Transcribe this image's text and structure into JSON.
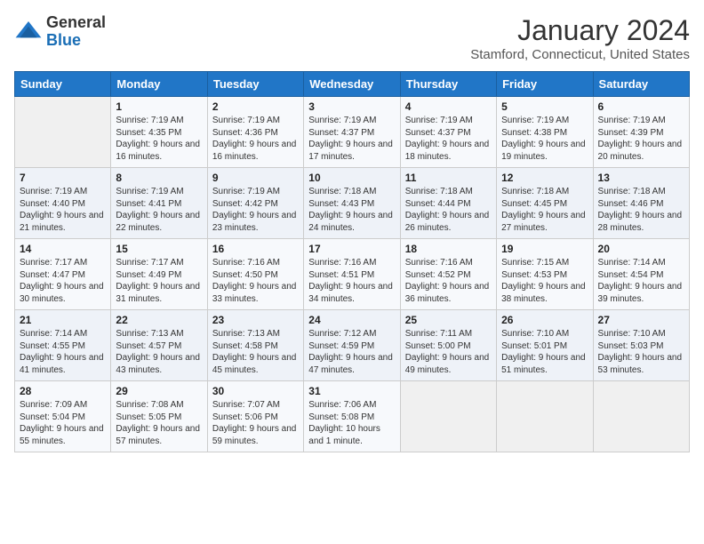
{
  "header": {
    "logo": {
      "general": "General",
      "blue": "Blue"
    },
    "month_title": "January 2024",
    "subtitle": "Stamford, Connecticut, United States"
  },
  "weekdays": [
    "Sunday",
    "Monday",
    "Tuesday",
    "Wednesday",
    "Thursday",
    "Friday",
    "Saturday"
  ],
  "weeks": [
    [
      {
        "day": "",
        "empty": true
      },
      {
        "day": "1",
        "sunrise": "Sunrise: 7:19 AM",
        "sunset": "Sunset: 4:35 PM",
        "daylight": "Daylight: 9 hours and 16 minutes."
      },
      {
        "day": "2",
        "sunrise": "Sunrise: 7:19 AM",
        "sunset": "Sunset: 4:36 PM",
        "daylight": "Daylight: 9 hours and 16 minutes."
      },
      {
        "day": "3",
        "sunrise": "Sunrise: 7:19 AM",
        "sunset": "Sunset: 4:37 PM",
        "daylight": "Daylight: 9 hours and 17 minutes."
      },
      {
        "day": "4",
        "sunrise": "Sunrise: 7:19 AM",
        "sunset": "Sunset: 4:37 PM",
        "daylight": "Daylight: 9 hours and 18 minutes."
      },
      {
        "day": "5",
        "sunrise": "Sunrise: 7:19 AM",
        "sunset": "Sunset: 4:38 PM",
        "daylight": "Daylight: 9 hours and 19 minutes."
      },
      {
        "day": "6",
        "sunrise": "Sunrise: 7:19 AM",
        "sunset": "Sunset: 4:39 PM",
        "daylight": "Daylight: 9 hours and 20 minutes."
      }
    ],
    [
      {
        "day": "7",
        "sunrise": "Sunrise: 7:19 AM",
        "sunset": "Sunset: 4:40 PM",
        "daylight": "Daylight: 9 hours and 21 minutes."
      },
      {
        "day": "8",
        "sunrise": "Sunrise: 7:19 AM",
        "sunset": "Sunset: 4:41 PM",
        "daylight": "Daylight: 9 hours and 22 minutes."
      },
      {
        "day": "9",
        "sunrise": "Sunrise: 7:19 AM",
        "sunset": "Sunset: 4:42 PM",
        "daylight": "Daylight: 9 hours and 23 minutes."
      },
      {
        "day": "10",
        "sunrise": "Sunrise: 7:18 AM",
        "sunset": "Sunset: 4:43 PM",
        "daylight": "Daylight: 9 hours and 24 minutes."
      },
      {
        "day": "11",
        "sunrise": "Sunrise: 7:18 AM",
        "sunset": "Sunset: 4:44 PM",
        "daylight": "Daylight: 9 hours and 26 minutes."
      },
      {
        "day": "12",
        "sunrise": "Sunrise: 7:18 AM",
        "sunset": "Sunset: 4:45 PM",
        "daylight": "Daylight: 9 hours and 27 minutes."
      },
      {
        "day": "13",
        "sunrise": "Sunrise: 7:18 AM",
        "sunset": "Sunset: 4:46 PM",
        "daylight": "Daylight: 9 hours and 28 minutes."
      }
    ],
    [
      {
        "day": "14",
        "sunrise": "Sunrise: 7:17 AM",
        "sunset": "Sunset: 4:47 PM",
        "daylight": "Daylight: 9 hours and 30 minutes."
      },
      {
        "day": "15",
        "sunrise": "Sunrise: 7:17 AM",
        "sunset": "Sunset: 4:49 PM",
        "daylight": "Daylight: 9 hours and 31 minutes."
      },
      {
        "day": "16",
        "sunrise": "Sunrise: 7:16 AM",
        "sunset": "Sunset: 4:50 PM",
        "daylight": "Daylight: 9 hours and 33 minutes."
      },
      {
        "day": "17",
        "sunrise": "Sunrise: 7:16 AM",
        "sunset": "Sunset: 4:51 PM",
        "daylight": "Daylight: 9 hours and 34 minutes."
      },
      {
        "day": "18",
        "sunrise": "Sunrise: 7:16 AM",
        "sunset": "Sunset: 4:52 PM",
        "daylight": "Daylight: 9 hours and 36 minutes."
      },
      {
        "day": "19",
        "sunrise": "Sunrise: 7:15 AM",
        "sunset": "Sunset: 4:53 PM",
        "daylight": "Daylight: 9 hours and 38 minutes."
      },
      {
        "day": "20",
        "sunrise": "Sunrise: 7:14 AM",
        "sunset": "Sunset: 4:54 PM",
        "daylight": "Daylight: 9 hours and 39 minutes."
      }
    ],
    [
      {
        "day": "21",
        "sunrise": "Sunrise: 7:14 AM",
        "sunset": "Sunset: 4:55 PM",
        "daylight": "Daylight: 9 hours and 41 minutes."
      },
      {
        "day": "22",
        "sunrise": "Sunrise: 7:13 AM",
        "sunset": "Sunset: 4:57 PM",
        "daylight": "Daylight: 9 hours and 43 minutes."
      },
      {
        "day": "23",
        "sunrise": "Sunrise: 7:13 AM",
        "sunset": "Sunset: 4:58 PM",
        "daylight": "Daylight: 9 hours and 45 minutes."
      },
      {
        "day": "24",
        "sunrise": "Sunrise: 7:12 AM",
        "sunset": "Sunset: 4:59 PM",
        "daylight": "Daylight: 9 hours and 47 minutes."
      },
      {
        "day": "25",
        "sunrise": "Sunrise: 7:11 AM",
        "sunset": "Sunset: 5:00 PM",
        "daylight": "Daylight: 9 hours and 49 minutes."
      },
      {
        "day": "26",
        "sunrise": "Sunrise: 7:10 AM",
        "sunset": "Sunset: 5:01 PM",
        "daylight": "Daylight: 9 hours and 51 minutes."
      },
      {
        "day": "27",
        "sunrise": "Sunrise: 7:10 AM",
        "sunset": "Sunset: 5:03 PM",
        "daylight": "Daylight: 9 hours and 53 minutes."
      }
    ],
    [
      {
        "day": "28",
        "sunrise": "Sunrise: 7:09 AM",
        "sunset": "Sunset: 5:04 PM",
        "daylight": "Daylight: 9 hours and 55 minutes."
      },
      {
        "day": "29",
        "sunrise": "Sunrise: 7:08 AM",
        "sunset": "Sunset: 5:05 PM",
        "daylight": "Daylight: 9 hours and 57 minutes."
      },
      {
        "day": "30",
        "sunrise": "Sunrise: 7:07 AM",
        "sunset": "Sunset: 5:06 PM",
        "daylight": "Daylight: 9 hours and 59 minutes."
      },
      {
        "day": "31",
        "sunrise": "Sunrise: 7:06 AM",
        "sunset": "Sunset: 5:08 PM",
        "daylight": "Daylight: 10 hours and 1 minute."
      },
      {
        "day": "",
        "empty": true
      },
      {
        "day": "",
        "empty": true
      },
      {
        "day": "",
        "empty": true
      }
    ]
  ]
}
